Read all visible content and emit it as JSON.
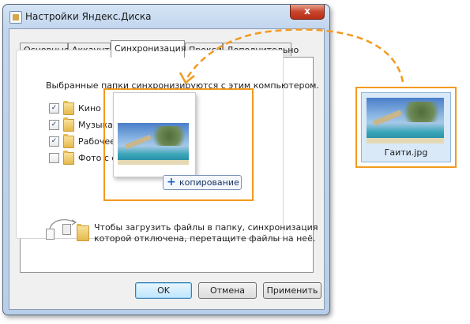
{
  "window": {
    "title": "Настройки Яндекс.Диска",
    "close_glyph": "x"
  },
  "tabs": [
    {
      "label": "Основные",
      "active": false
    },
    {
      "label": "Аккаунт",
      "active": false
    },
    {
      "label": "Синхронизация",
      "active": true
    },
    {
      "label": "Прокси",
      "active": false
    },
    {
      "label": "Дополнительно",
      "active": false
    }
  ],
  "sync": {
    "description": "Выбранные папки синхронизируются с этим компьютером.",
    "folders": [
      {
        "label": "Кино",
        "checked": true
      },
      {
        "label": "Музыка",
        "checked": true
      },
      {
        "label": "Рабочее",
        "checked": true
      },
      {
        "label": "Фото с отдыха",
        "checked": false
      }
    ],
    "check_glyph": "✓",
    "copy_badge": "копирование",
    "copy_icon": "plus-icon",
    "hint_line1": "Чтобы загрузить файлы в папку, синхронизация",
    "hint_line2": "которой отключена, перетащите файлы на неё."
  },
  "buttons": {
    "ok": "OK",
    "cancel": "Отмена",
    "apply": "Применить"
  },
  "dragged_file": {
    "name": "Гаити.jpg"
  },
  "colors": {
    "highlight": "#f39a1e",
    "window_frame": "#c2d6ee",
    "accent_blue": "#1f5fc4"
  }
}
